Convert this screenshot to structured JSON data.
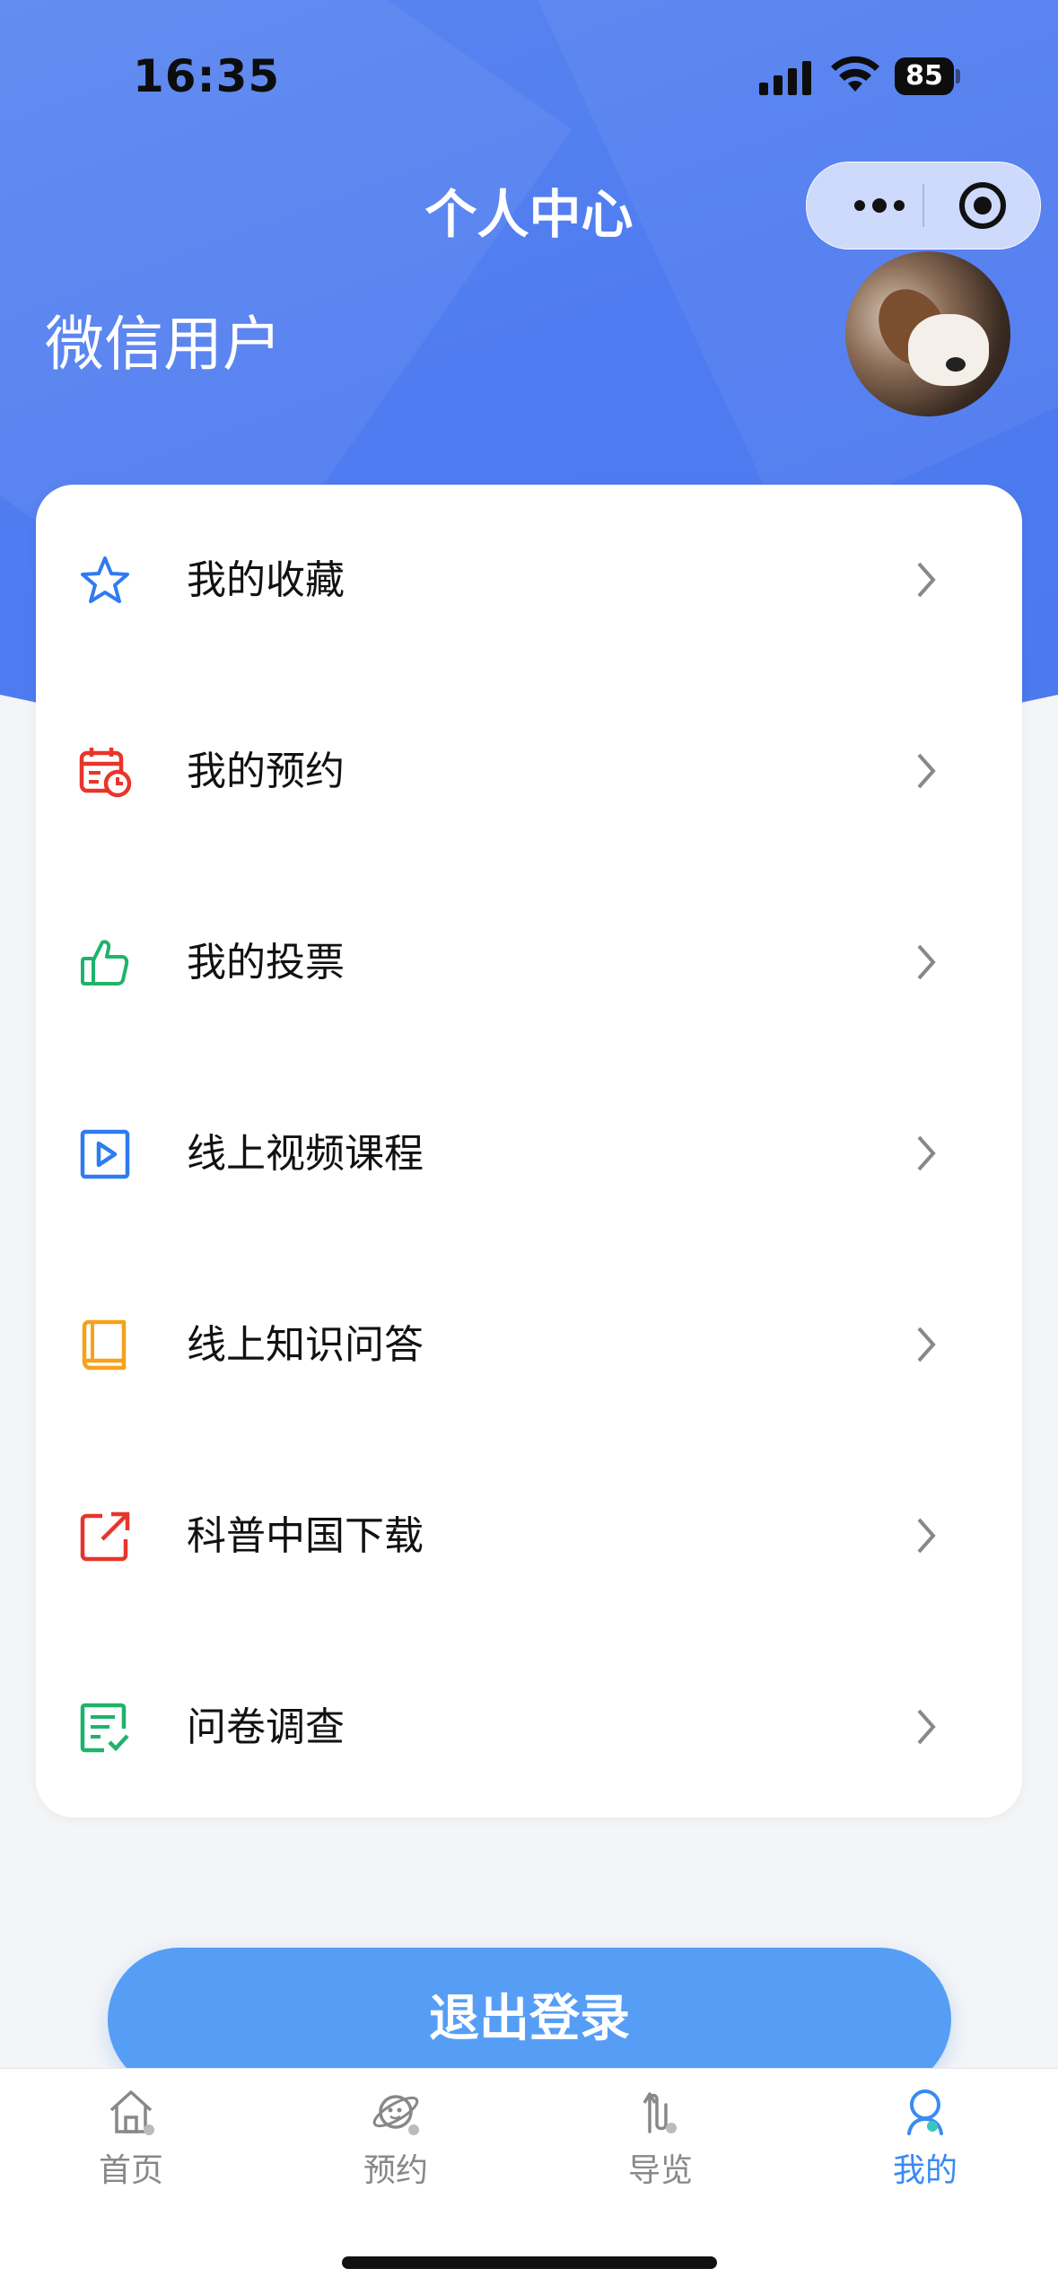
{
  "status_bar": {
    "time": "16:35",
    "battery": "85"
  },
  "header": {
    "title": "个人中心"
  },
  "user": {
    "name": "微信用户"
  },
  "menu": [
    {
      "label": "我的收藏",
      "icon": "star-icon",
      "color": "#2f7bf0"
    },
    {
      "label": "我的预约",
      "icon": "calendar-clock-icon",
      "color": "#e8352b"
    },
    {
      "label": "我的投票",
      "icon": "thumbs-up-icon",
      "color": "#1fb36b"
    },
    {
      "label": "线上视频课程",
      "icon": "video-play-icon",
      "color": "#2f7bf0"
    },
    {
      "label": "线上知识问答",
      "icon": "book-icon",
      "color": "#f5a21b"
    },
    {
      "label": "科普中国下载",
      "icon": "external-link-icon",
      "color": "#e8352b"
    },
    {
      "label": "问卷调查",
      "icon": "survey-check-icon",
      "color": "#1fb36b"
    }
  ],
  "logout_label": "退出登录",
  "tabbar": [
    {
      "label": "首页",
      "icon": "home-icon",
      "active": false
    },
    {
      "label": "预约",
      "icon": "planet-icon",
      "active": false
    },
    {
      "label": "导览",
      "icon": "route-icon",
      "active": false
    },
    {
      "label": "我的",
      "icon": "user-icon",
      "active": true
    }
  ],
  "colors": {
    "accent": "#3a8af5",
    "header_blue": "#4f7cf0",
    "button_blue": "#569ef5"
  }
}
